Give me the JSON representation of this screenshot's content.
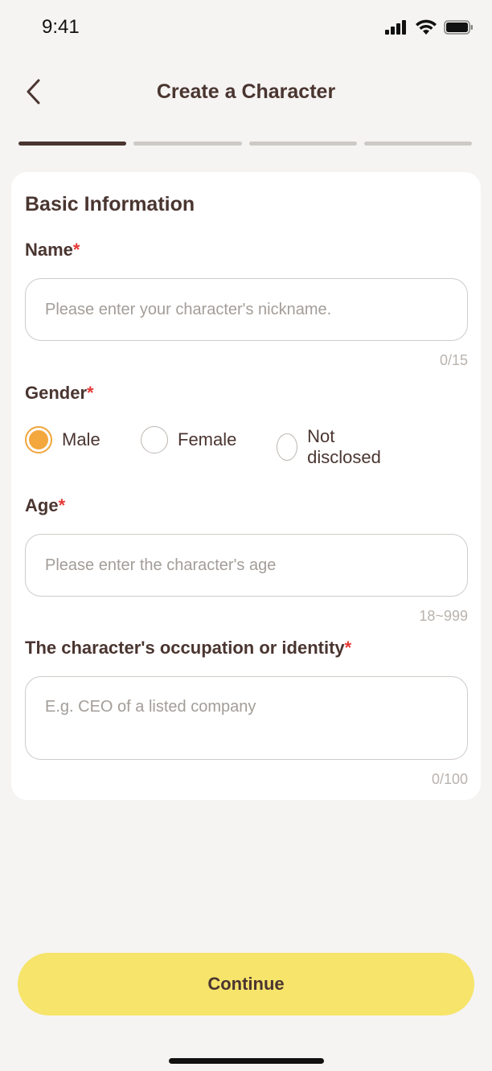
{
  "status_bar": {
    "time": "9:41"
  },
  "nav": {
    "title": "Create a Character"
  },
  "progress": {
    "steps": 4,
    "current": 1
  },
  "form": {
    "section_title": "Basic Information",
    "name": {
      "label": "Name",
      "required_mark": "*",
      "placeholder": "Please enter your character's nickname.",
      "counter": "0/15"
    },
    "gender": {
      "label": "Gender",
      "required_mark": "*",
      "options": [
        "Male",
        "Female",
        "Not disclosed"
      ],
      "selected": "Male"
    },
    "age": {
      "label": "Age",
      "required_mark": "*",
      "placeholder": "Please enter the character's age",
      "hint": "18~999"
    },
    "occupation": {
      "label": "The character's occupation or identity",
      "required_mark": "*",
      "placeholder": "E.g. CEO of a listed company",
      "counter": "0/100"
    }
  },
  "footer": {
    "continue_label": "Continue"
  },
  "colors": {
    "accent": "#f3a73c",
    "button": "#f6e46b",
    "text": "#4a3530",
    "required": "#e53935"
  }
}
